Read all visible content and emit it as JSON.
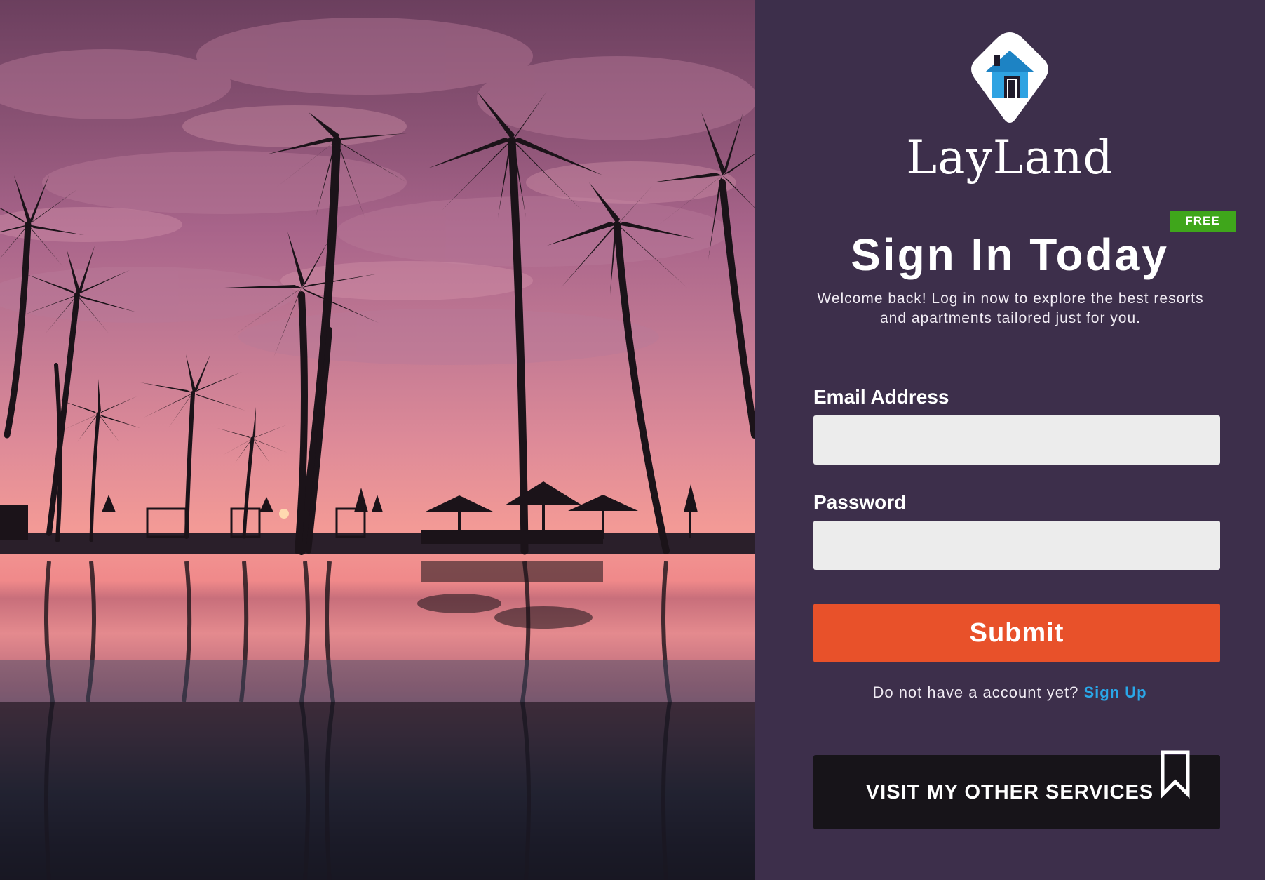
{
  "hero": {
    "image_description_icon": "palm-sunset-photo"
  },
  "brand": {
    "name": "LayLand",
    "logo_icon": "house-pin-icon"
  },
  "badge": {
    "label": "FREE"
  },
  "heading": {
    "title": "Sign In Today",
    "subtitle": "Welcome back! Log in now to explore the best resorts and apartments tailored just for you."
  },
  "form": {
    "email_label": "Email Address",
    "email_value": "",
    "email_placeholder": "",
    "password_label": "Password",
    "password_value": "",
    "password_placeholder": "",
    "submit_label": "Submit"
  },
  "signup": {
    "prompt": "Do not have a account yet?",
    "link_label": "Sign Up"
  },
  "services": {
    "label": "VISIT MY OTHER SERVICES",
    "icon": "bookmark-icon"
  },
  "colors": {
    "panel_bg": "#3d2f4b",
    "accent": "#e8512a",
    "link": "#2aa7e8",
    "badge": "#3fa61b",
    "dark_button": "#171419"
  }
}
